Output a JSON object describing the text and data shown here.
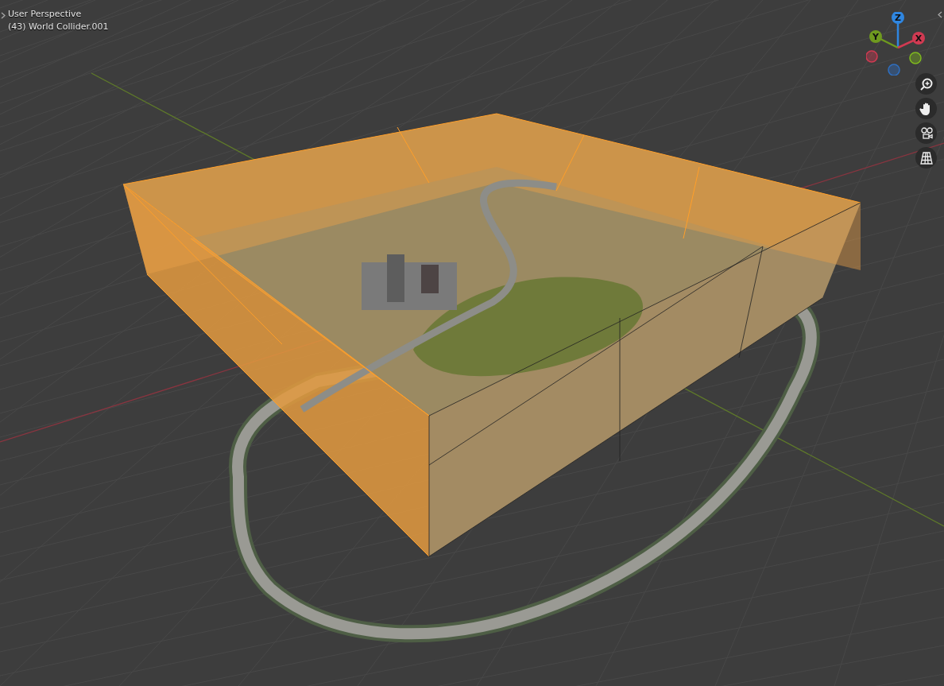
{
  "viewport": {
    "view_name": "User Perspective",
    "object_label": "(43) World Collider.001"
  },
  "gizmo": {
    "axes": [
      {
        "label": "Z",
        "color": "#2f86e0",
        "positive": true
      },
      {
        "label": "Y",
        "color": "#6f9a1f",
        "positive": true
      },
      {
        "label": "X",
        "color": "#d13a52",
        "positive": true
      },
      {
        "color": "#d13a52",
        "positive": false
      },
      {
        "color": "#7fba1e",
        "positive": false
      },
      {
        "color": "#2f6fc0",
        "positive": false
      }
    ]
  },
  "nav_buttons": [
    {
      "kind": "zoom"
    },
    {
      "kind": "pan"
    },
    {
      "kind": "camera"
    },
    {
      "kind": "ortho"
    }
  ]
}
